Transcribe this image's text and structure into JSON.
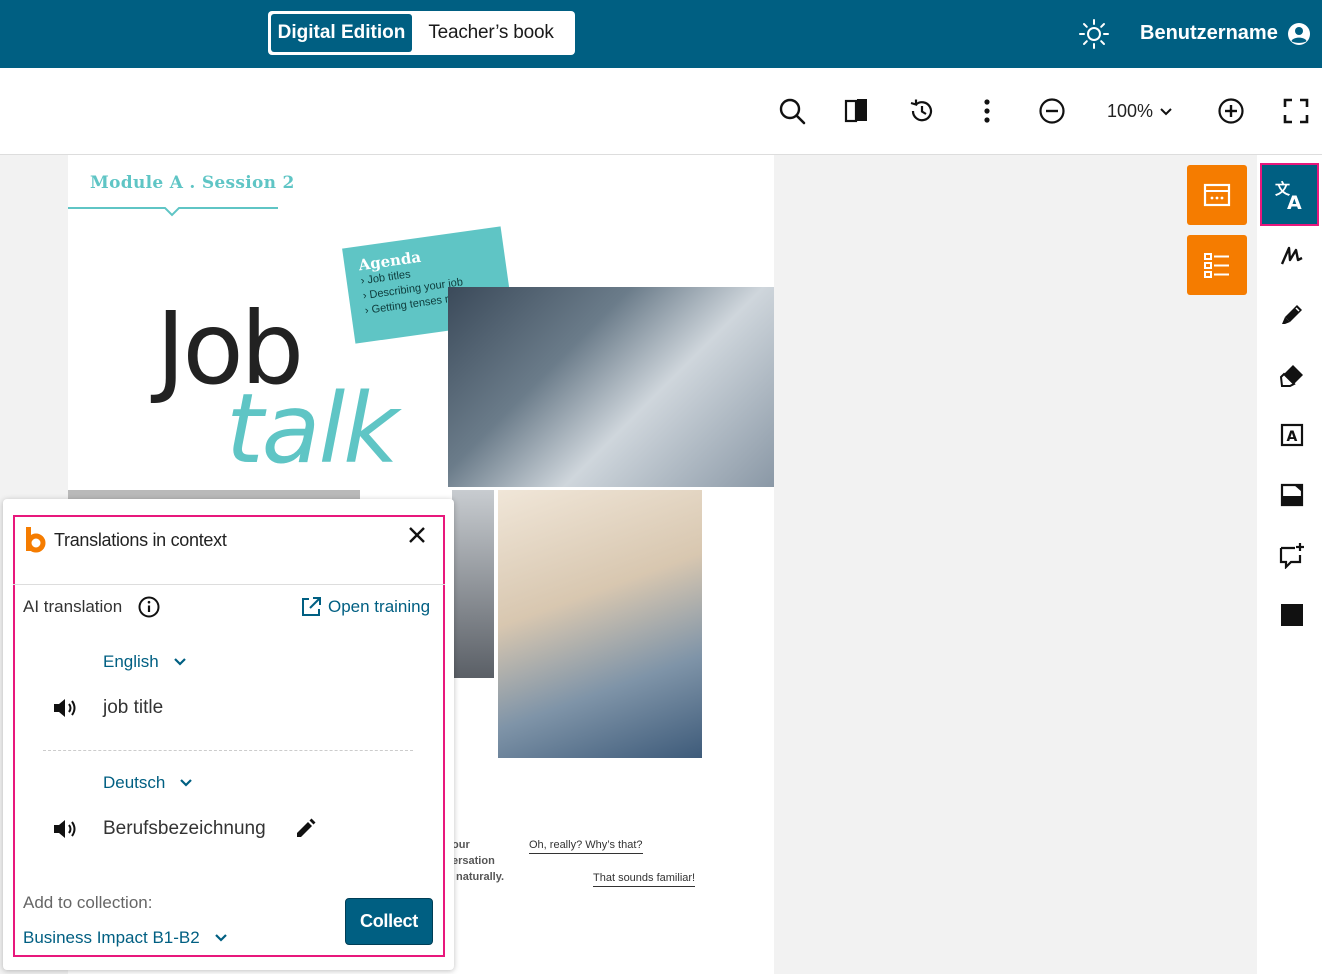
{
  "topbar": {
    "tabs": [
      {
        "label": "Digital Edition",
        "active": true
      },
      {
        "label": "Teacher’s book",
        "active": false
      }
    ],
    "username": "Benutzername",
    "theme_icon": "sun-icon",
    "user_icon": "user-circle-icon"
  },
  "toolbar": {
    "zoom": "100%",
    "icons": [
      "search-icon",
      "book-pages-icon",
      "history-icon",
      "more-vertical-icon",
      "zoom-out-icon",
      "zoom-in-icon",
      "fullscreen-icon"
    ]
  },
  "page": {
    "module": "Module A . Session 2",
    "title_job": "Job",
    "title_talk": "talk",
    "agenda": {
      "title": "Agenda",
      "items": [
        "Job titles",
        "Describing your job",
        "Getting tenses right"
      ]
    },
    "speech1": "Oh, really? Why’s that?",
    "speech2": "That sounds familiar!",
    "fragments": [
      "our",
      "ersation",
      "naturally."
    ]
  },
  "panel": {
    "title": "Translations in context",
    "ai_label": "AI translation",
    "open_training": "Open training",
    "source_lang": "English",
    "source_term": "job title",
    "target_lang": "Deutsch",
    "target_term": "Berufsbezeichnung",
    "collection_label": "Add to collection:",
    "collection_value": "Business Impact B1-B2",
    "collect_button": "Collect"
  },
  "colors": {
    "brand": "#005f82",
    "accent_orange": "#f57c00",
    "highlight_pink": "#e8187c",
    "teal": "#5fc5c5"
  }
}
